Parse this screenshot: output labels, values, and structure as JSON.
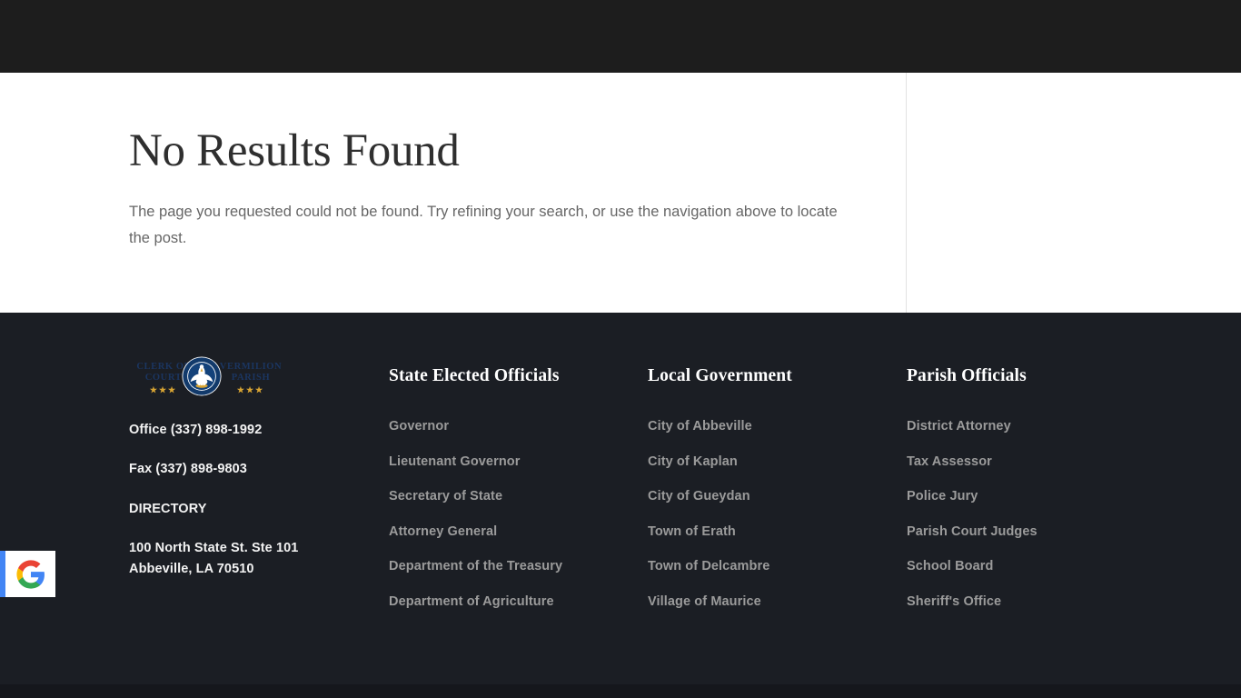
{
  "header": {
    "bar_color": "#1d1d1d"
  },
  "main": {
    "title": "No Results Found",
    "message": "The page you requested could not be found. Try refining your search, or use the navigation above to locate the post."
  },
  "footer": {
    "background": "#1b1e24",
    "brand": {
      "logo_text_left": "Clerk of Court",
      "logo_text_right": "Vermilion Parish",
      "logo_stars": "★★★",
      "seal_text": "State of Louisiana",
      "seal_motto": "Union Justice Confidence",
      "navy": "#1b3560",
      "gold": "#d9a533"
    },
    "contact": {
      "office": "Office (337) 898-1992",
      "fax": "Fax (337) 898-9803",
      "directory": "DIRECTORY",
      "address_line1": "100 North State St. Ste 101",
      "address_line2": "Abbeville, LA 70510"
    },
    "columns": [
      {
        "heading": "State Elected Officials",
        "links": [
          "Governor",
          "Lieutenant Governor",
          "Secretary of State",
          "Attorney General",
          "Department of the Treasury",
          "Department of Agriculture"
        ]
      },
      {
        "heading": "Local Government",
        "links": [
          "City of Abbeville",
          "City of Kaplan",
          "City of Gueydan",
          "Town of Erath",
          "Town of Delcambre",
          "Village of Maurice"
        ]
      },
      {
        "heading": "Parish Officials",
        "links": [
          "District Attorney",
          "Tax Assessor",
          "Police Jury",
          "Parish Court Judges",
          "School Board",
          "Sheriff's Office"
        ]
      }
    ]
  },
  "google_badge": {
    "icon": "google-g-icon",
    "accent": "#4285f4",
    "colors": {
      "blue": "#4285f4",
      "red": "#ea4335",
      "yellow": "#fbbc05",
      "green": "#34a853"
    }
  }
}
